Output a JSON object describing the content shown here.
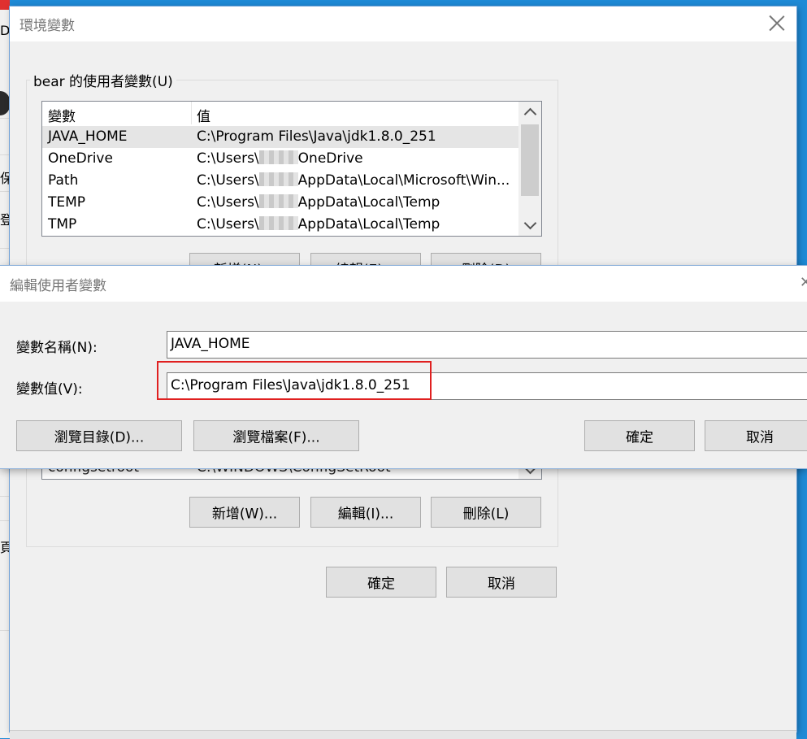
{
  "env_dialog": {
    "title": "環境變數",
    "user_vars_group": "bear 的使用者變數(U)",
    "columns": [
      "變數",
      "值"
    ],
    "rows": [
      {
        "name": "JAVA_HOME",
        "value_pre": "C:\\Program Files\\Java\\jdk1.8.0_251",
        "value_post": ""
      },
      {
        "name": "OneDrive",
        "value_pre": "C:\\Users\\",
        "value_post": "OneDrive"
      },
      {
        "name": "Path",
        "value_pre": "C:\\Users\\",
        "value_post": "AppData\\Local\\Microsoft\\Win..."
      },
      {
        "name": "TEMP",
        "value_pre": "C:\\Users\\",
        "value_post": "AppData\\Local\\Temp"
      },
      {
        "name": "TMP",
        "value_pre": "C:\\Users\\",
        "value_post": "AppData\\Local\\Temp"
      }
    ],
    "user_buttons": [
      "新增(N)...",
      "編輯(E)...",
      "刪除(D)"
    ],
    "system_row_partial": {
      "name": "configsetroot",
      "value": "C:\\WINDOWS\\ConfigSetRoot"
    },
    "system_buttons": [
      "新增(W)...",
      "編輯(I)...",
      "刪除(L)"
    ],
    "ok": "確定",
    "cancel": "取消"
  },
  "edit_dialog": {
    "title": "編輯使用者變數",
    "name_label": "變數名稱(N):",
    "name_value": "JAVA_HOME",
    "value_label": "變數值(V):",
    "value_value": "C:\\Program Files\\Java\\jdk1.8.0_251",
    "browse_dir": "瀏覽目錄(D)...",
    "browse_file": "瀏覽檔案(F)...",
    "ok": "確定",
    "cancel": "取消"
  },
  "background": {
    "glyphs": [
      "D",
      "保",
      "登",
      "頁"
    ]
  },
  "colors": {
    "highlight": "#e02020",
    "desktop": "#1e8ad6"
  }
}
